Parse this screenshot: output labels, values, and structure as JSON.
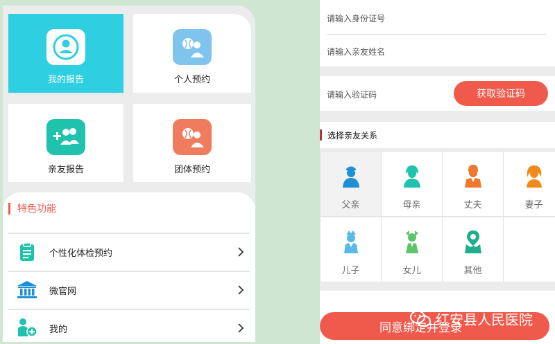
{
  "left": {
    "tiles": [
      {
        "label": "我的报告",
        "icon": "user-avatar-icon"
      },
      {
        "label": "个人预约",
        "icon": "person-appointment-icon"
      },
      {
        "label": "亲友报告",
        "icon": "add-family-icon"
      },
      {
        "label": "团体预约",
        "icon": "group-appointment-icon"
      }
    ],
    "features_title": "特色功能",
    "features": [
      {
        "label": "个性化体检预约",
        "icon": "clipboard-icon"
      },
      {
        "label": "微官网",
        "icon": "bank-building-icon"
      },
      {
        "label": "我的",
        "icon": "user-plus-icon"
      }
    ]
  },
  "right": {
    "id_placeholder": "请输入身份证号",
    "name_placeholder": "请输入亲友姓名",
    "code_placeholder": "请输入验证码",
    "get_code_label": "获取验证码",
    "relation_title": "选择亲友关系",
    "relations": [
      {
        "label": "父亲",
        "icon": "father-icon",
        "selected": true
      },
      {
        "label": "母亲",
        "icon": "mother-icon"
      },
      {
        "label": "丈夫",
        "icon": "husband-icon"
      },
      {
        "label": "妻子",
        "icon": "wife-icon"
      },
      {
        "label": "儿子",
        "icon": "son-icon"
      },
      {
        "label": "女儿",
        "icon": "daughter-icon"
      },
      {
        "label": "其他",
        "icon": "other-icon"
      }
    ],
    "agree_label": "同意绑定并登录"
  },
  "watermark": "红安县人民医院",
  "colors": {
    "accent_red": "#f05a4c",
    "cyan": "#2dcfe0",
    "light_blue": "#7ec4ec",
    "teal": "#1fc2ad",
    "salmon": "#f07c60",
    "page_bg": "#cfe6d2"
  }
}
